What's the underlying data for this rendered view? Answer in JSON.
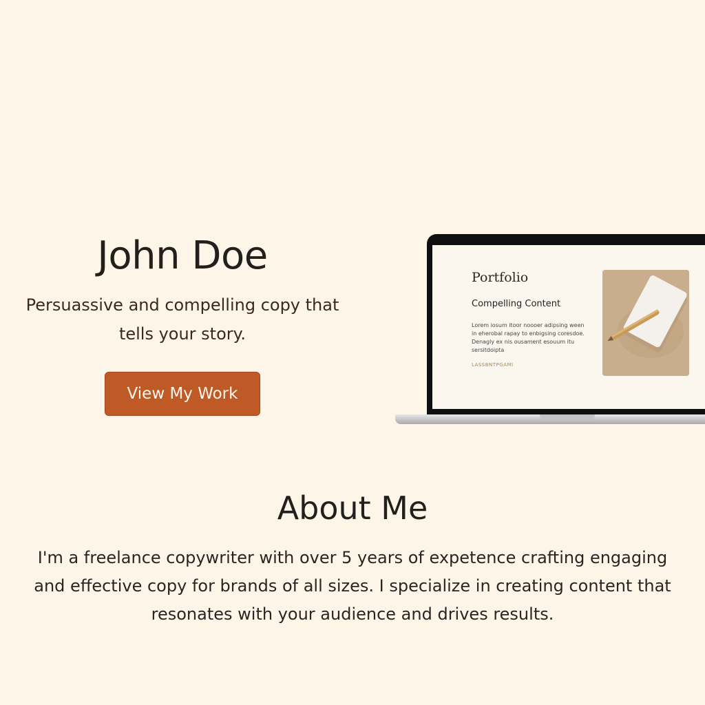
{
  "hero": {
    "name": "John Doe",
    "tagline": "Persuassive and compelling copy that tells your story.",
    "cta_label": "View My Work"
  },
  "laptop_screen": {
    "title": "Portfolio",
    "subtitle": "Compelling Content",
    "body": "Lorem iosum itoor noooer adipsing ween in eherobal rapay to enbigsing coresdoe. Denagly ex nis ousament esouum itu sersitdoipta",
    "link": "LASSBNTPGAMI",
    "image": "notepad-and-pencil-photo"
  },
  "about": {
    "heading": "About Me",
    "body": "I'm a freelance copywriter with over 5 years of expetence crafting engaging and effective copy for brands of all sizes. I specialize in creating content that resonates with your audience and drives results."
  },
  "colors": {
    "background": "#fdf5e8",
    "accent": "#bf5a27",
    "text": "#2a2522"
  }
}
